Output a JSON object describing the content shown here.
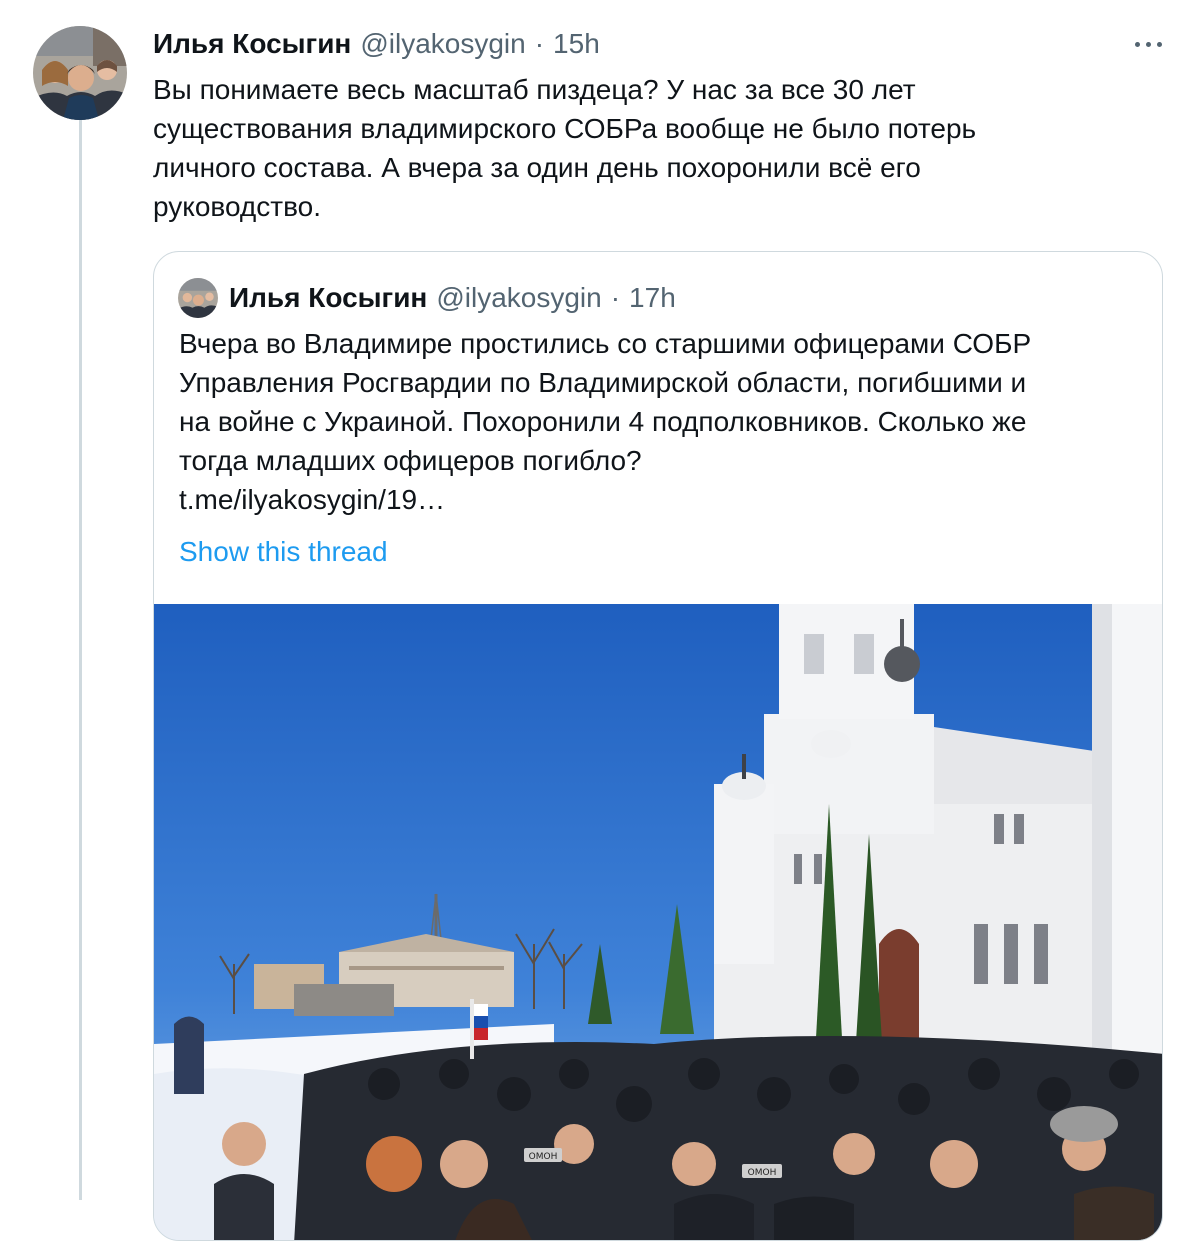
{
  "tweet": {
    "author_name": "Илья Косыгин",
    "handle": "@ilyakosygin",
    "separator": "·",
    "time": "15h",
    "text_lines": [
      "Вы понимаете весь масштаб пиздеца? У нас за все 30 лет",
      "существования владимирского СОБРа вообще не было потерь",
      "личного состава. А вчера за один день похоронили всё его",
      "руководство."
    ]
  },
  "quoted": {
    "author_name": "Илья Косыгин",
    "handle": "@ilyakosygin",
    "separator": "·",
    "time": "17h",
    "text_lines": [
      "Вчера во Владимире простились со старшими офицерами СОБР",
      "Управления Росгвардии по Владимирской области, погибшими и",
      "на войне с Украиной. Похоронили 4 подполковников. Сколько же",
      "тогда младших офицеров погибло?",
      "t.me/ilyakosygin/19…"
    ],
    "show_thread_label": "Show this thread",
    "photo_text": {
      "badge_1": "ОМОН",
      "badge_2": "ОМОН"
    }
  },
  "icons": {
    "more": "more-horizontal-icon"
  },
  "colors": {
    "text": "#0f1419",
    "muted": "#536471",
    "link": "#1d9bf0",
    "border": "#cfd9de"
  }
}
